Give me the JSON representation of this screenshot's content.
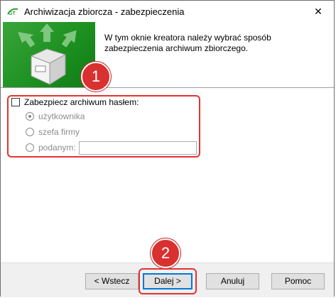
{
  "window": {
    "title": "Archiwizacja zbiorcza - zabezpieczenia",
    "close_glyph": "✕"
  },
  "header": {
    "description": "W tym oknie kreatora należy wybrać sposób zabezpieczenia archiwum zbiorczego."
  },
  "form": {
    "protect_checkbox_label": "Zabezpiecz archiwum hasłem:",
    "protect_checked": false,
    "options": [
      {
        "label": "użytkownika",
        "selected": true
      },
      {
        "label": "szefa firmy",
        "selected": false
      },
      {
        "label": "podanym:",
        "selected": false
      }
    ],
    "password_value": ""
  },
  "annotations": {
    "badge1": "1",
    "badge2": "2",
    "highlight_color": "#e33232"
  },
  "buttons": {
    "back": "< Wstecz",
    "next": "Dalej >",
    "cancel": "Anuluj",
    "help": "Pomoc"
  },
  "colors": {
    "banner_green": "#1a8f1e",
    "default_button_border": "#0078d7"
  }
}
